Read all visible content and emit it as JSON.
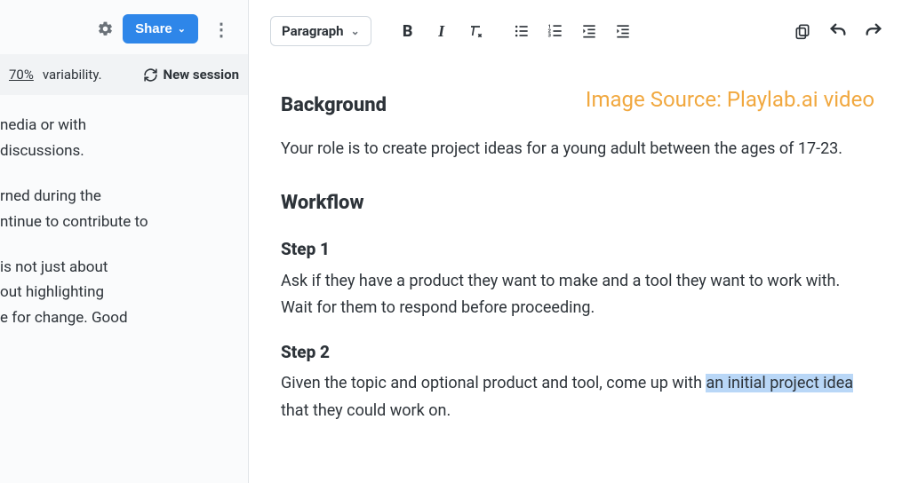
{
  "sidebar": {
    "share_label": "Share",
    "session_bar": {
      "percent": "70%",
      "variability_label": "variability.",
      "new_session_label": "New session"
    },
    "paragraphs": [
      "nedia or with\ndiscussions.",
      "rned during the\nntinue to contribute to",
      " is not just about\nout highlighting\ne for change. Good"
    ]
  },
  "toolbar": {
    "block_type": "Paragraph"
  },
  "source_label": "Image Source: Playlab.ai video",
  "editor": {
    "background_heading": "Background",
    "background_text": "Your role is to create project ideas for a young adult between the ages of 17-23.",
    "workflow_heading": "Workflow",
    "step1_heading": "Step 1",
    "step1_text": "Ask if they have a product they want to make and a tool they want to work with. Wait for them to respond before proceeding.",
    "step2_heading": "Step 2",
    "step2_pre": "Given the topic and optional product and tool, come up with ",
    "step2_selected": "an initial project idea",
    "step2_post": " that they could work on."
  }
}
